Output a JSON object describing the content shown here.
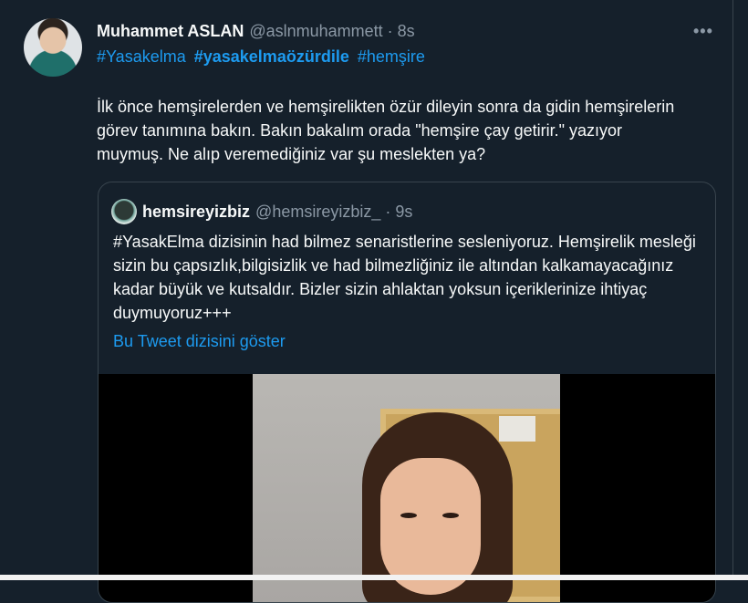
{
  "tweet": {
    "author_name": "Muhammet ASLAN",
    "author_handle": "@aslnmuhammett",
    "separator": "·",
    "time": "8s",
    "more_icon": "more-horizontal-icon",
    "hashtags": [
      {
        "text": "#Yasakelma",
        "bold": false
      },
      {
        "text": "#yasakelmaözürdile",
        "bold": true
      },
      {
        "text": "#hemşire",
        "bold": false
      }
    ],
    "text": "İlk önce hemşirelerden ve hemşirelikten özür dileyin sonra da gidin hemşirelerin görev tanımına bakın. Bakın bakalım orada \"hemşire çay getirir.\" yazıyor muymuş. Ne alıp veremediğiniz var şu meslekten ya?"
  },
  "quote": {
    "author_name": "hemsireyizbiz",
    "author_handle": "@hemsireyizbiz_",
    "separator": "·",
    "time": "9s",
    "text": "#YasakElma dizisinin had bilmez senaristlerine sesleniyoruz. Hemşirelik mesleği sizin bu çapsızlık,bilgisizlik ve had bilmezliğiniz ile altından kalkamayacağınız kadar büyük ve kutsaldır. Bizler sizin ahlaktan yoksun içeriklerinize ihtiyaç duymuyoruz+++",
    "thread_link": "Bu Tweet dizisini göster"
  },
  "colors": {
    "background": "#15202b",
    "link": "#1d9bf0",
    "secondary_text": "#8b98a5",
    "border": "#38444d"
  }
}
